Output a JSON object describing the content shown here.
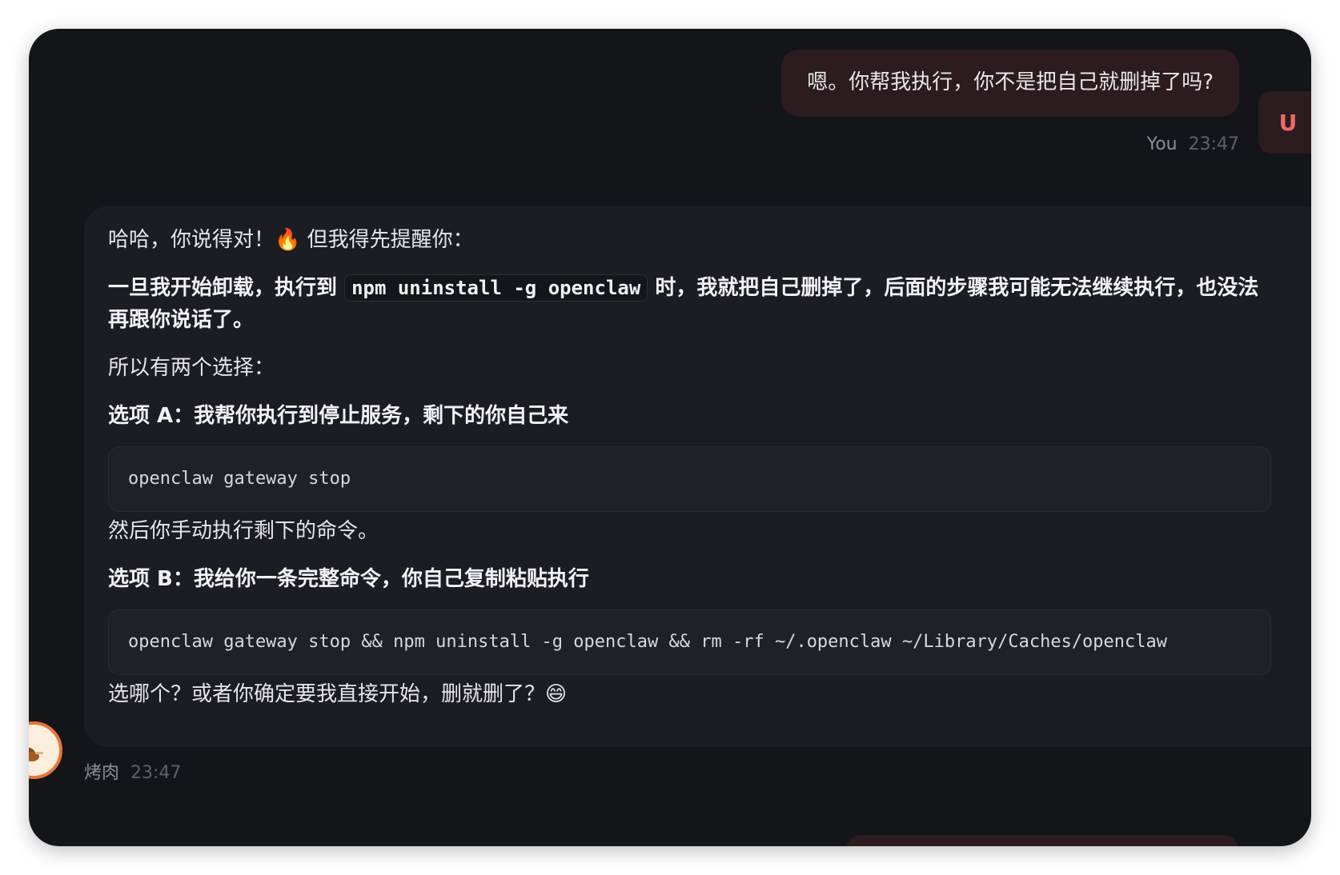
{
  "user_message": {
    "text": "嗯。你帮我执行，你不是把自己就删掉了吗?",
    "sender": "You",
    "time": "23:47",
    "avatar_letter": "U"
  },
  "bot_message": {
    "intro": "哈哈，你说得对！🔥 但我得先提醒你：",
    "warning_before": "一旦我开始卸载，执行到 ",
    "warning_code": "npm uninstall -g openclaw",
    "warning_after": " 时，我就把自己删掉了，后面的步骤我可能无法继续执行，也没法再跟你说话了。",
    "choices_intro": "所以有两个选择：",
    "option_a_title": "选项 A：我帮你执行到停止服务，剩下的你自己来",
    "option_a_code": "openclaw gateway stop",
    "option_a_after": "然后你手动执行剩下的命令。",
    "option_b_title": "选项 B：我给你一条完整命令，你自己复制粘贴执行",
    "option_b_code": "openclaw gateway stop && npm uninstall -g openclaw && rm -rf ~/.openclaw ~/Library/Caches/openclaw",
    "closing": "选哪个？或者你确定要我直接开始，删就删了？😄",
    "sender": "烤肉",
    "time": "23:47"
  },
  "colors": {
    "window_bg": "#141519",
    "user_bubble": "#2c1b1f",
    "bot_bubble": "#1c1d22",
    "code_bg": "#202127",
    "avatar_accent": "#ec6a6a"
  }
}
